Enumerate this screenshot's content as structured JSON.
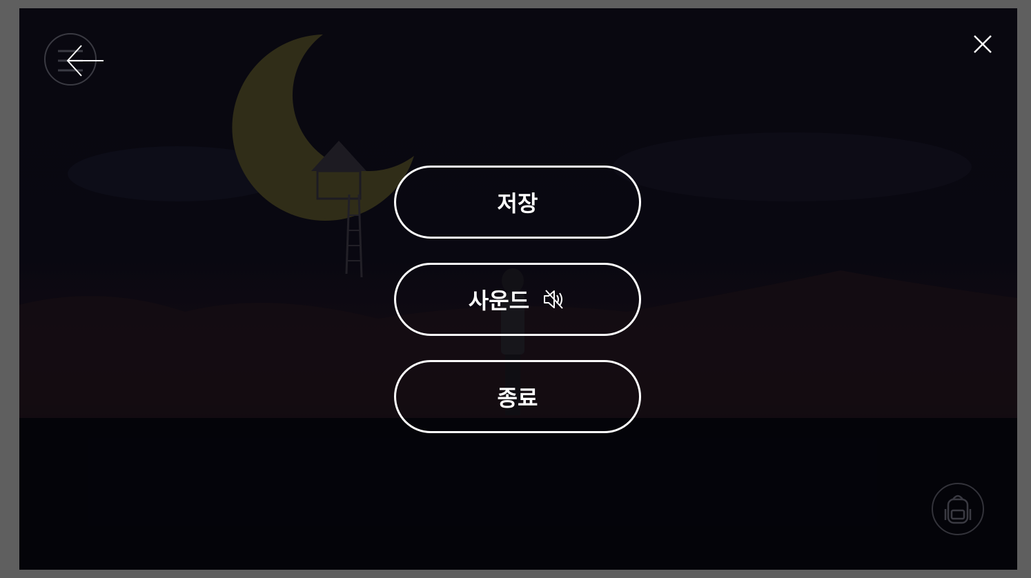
{
  "menu": {
    "save_label": "저장",
    "sound_label": "사운드",
    "sound_state": "muted",
    "quit_label": "종료"
  },
  "icons": {
    "back": "back-arrow-icon",
    "close": "close-icon",
    "sound": "speaker-muted-icon",
    "inventory": "backpack-icon"
  },
  "colors": {
    "button_border": "#ffffff",
    "button_text": "#ffffff",
    "backdrop": "#0b0a14",
    "moon": "#3b371e"
  }
}
